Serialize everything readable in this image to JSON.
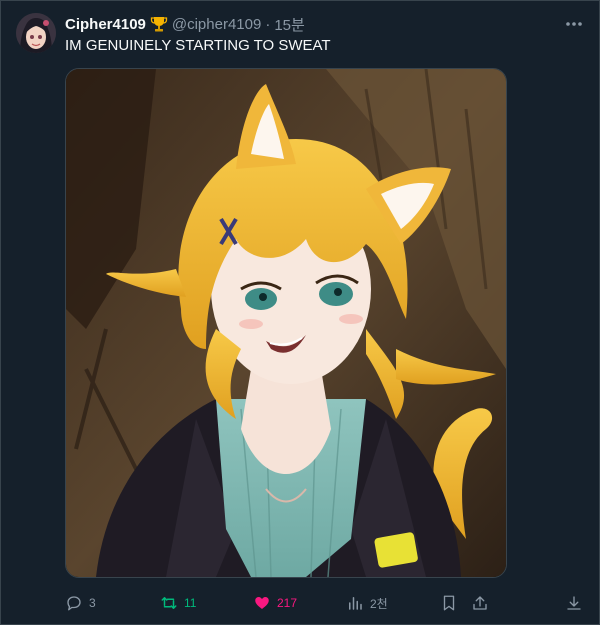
{
  "post": {
    "display_name": "Cipher4109",
    "badge_icon": "trophy-icon",
    "handle": "@cipher4109",
    "separator": "·",
    "time_ago": "15분",
    "text": "IM GENUINELY STARTING TO SWEAT"
  },
  "actions": {
    "reply_count": "3",
    "retweet_count": "11",
    "like_count": "217",
    "view_count": "2천"
  },
  "colors": {
    "background": "#15202b",
    "retweet_active": "#00ba7c",
    "like_active": "#f91880",
    "muted": "#8b98a5"
  }
}
